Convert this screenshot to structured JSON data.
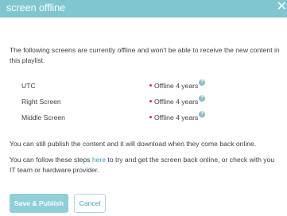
{
  "dialog": {
    "title": "screen offline",
    "close_symbol": "✕",
    "intro": "The following screens are currently offline and won't be able to receive the new content in this playlist."
  },
  "screens": [
    {
      "name": "UTC",
      "status": "Offline 4 years"
    },
    {
      "name": "Right Screen",
      "status": "Offline 4 years"
    },
    {
      "name": "Middle Screen",
      "status": "Offline 4 years"
    }
  ],
  "help_symbol": "?",
  "publish_note": "You can still publish the content and it will download when they come back online.",
  "steps": {
    "before": "You can follow these steps ",
    "link": "here",
    "after": " to try and get the screen back online, or check with you IT team or hardware provider."
  },
  "buttons": {
    "save_publish": "Save & Publish",
    "cancel": "Cancel"
  },
  "colors": {
    "header": "#7fc6cf",
    "primary_button": "#8ecfd8",
    "link": "#3aa0b5",
    "offline_dot": "#d9342b",
    "help_icon": "#8cbcc6"
  },
  "icons": {
    "close": "close-icon",
    "help": "help-icon",
    "status": "offline-dot-icon"
  }
}
